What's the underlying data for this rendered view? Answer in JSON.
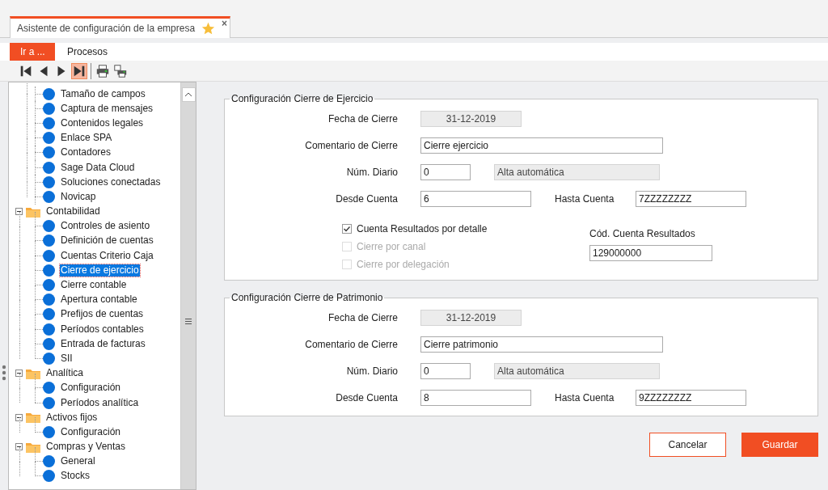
{
  "tab": {
    "title": "Asistente de configuración de la empresa",
    "selected": true,
    "favorite": true,
    "close": "×"
  },
  "menu": [
    {
      "label": "Ir a ...",
      "selected": true
    },
    {
      "label": "Procesos",
      "selected": false
    }
  ],
  "toolbar": [
    [
      {
        "kind": "first",
        "selected": false
      },
      {
        "kind": "prev",
        "selected": false
      },
      {
        "kind": "next",
        "selected": false
      },
      {
        "kind": "last",
        "selected": true
      }
    ],
    [
      {
        "kind": "print",
        "selected": false
      },
      {
        "kind": "print-setup",
        "selected": false
      }
    ]
  ],
  "tree": {
    "orphans": [
      {
        "label": "Tamaño de campos",
        "selected": false
      },
      {
        "label": "Captura de mensajes",
        "selected": false
      },
      {
        "label": "Contenidos legales",
        "selected": false
      },
      {
        "label": "Enlace SPA",
        "selected": false
      },
      {
        "label": "Contadores",
        "selected": false
      },
      {
        "label": "Sage Data Cloud",
        "selected": false
      },
      {
        "label": "Soluciones conectadas",
        "selected": false
      },
      {
        "label": "Novicap",
        "selected": false
      }
    ],
    "folders": [
      {
        "label": "Contabilidad",
        "expanded": true,
        "children": [
          {
            "label": "Controles de asiento",
            "selected": false
          },
          {
            "label": "Definición de cuentas",
            "selected": false
          },
          {
            "label": "Cuentas Criterio Caja",
            "selected": false
          },
          {
            "label": "Cierre de ejercicio",
            "selected": true
          },
          {
            "label": "Cierre contable",
            "selected": false
          },
          {
            "label": "Apertura contable",
            "selected": false
          },
          {
            "label": "Prefijos de cuentas",
            "selected": false
          },
          {
            "label": "Períodos contables",
            "selected": false
          },
          {
            "label": "Entrada de facturas",
            "selected": false
          },
          {
            "label": "SII",
            "selected": false
          }
        ]
      },
      {
        "label": "Analítica",
        "expanded": true,
        "children": [
          {
            "label": "Configuración",
            "selected": false
          },
          {
            "label": "Períodos analítica",
            "selected": false
          }
        ]
      },
      {
        "label": "Activos fijos",
        "expanded": true,
        "children": [
          {
            "label": "Configuración",
            "selected": false
          }
        ]
      },
      {
        "label": "Compras y Ventas",
        "expanded": true,
        "children": [
          {
            "label": "General",
            "selected": false
          },
          {
            "label": "Stocks",
            "selected": false
          }
        ]
      }
    ]
  },
  "sections": [
    {
      "title": "Configuración Cierre de Ejercicio",
      "rows": [
        {
          "label": "Fecha de Cierre",
          "field": {
            "kind": "date",
            "value": "31-12-2019",
            "disabled": true
          }
        },
        {
          "label": "Comentario de Cierre",
          "field": {
            "kind": "wide",
            "value": "Cierre ejercicio",
            "disabled": false
          }
        },
        {
          "label": "Núm. Diario",
          "field": {
            "kind": "short",
            "value": "0",
            "disabled": false
          },
          "side": {
            "field": {
              "kind": "info",
              "value": "Alta automática",
              "disabled": true
            }
          }
        },
        {
          "label": "Desde Cuenta",
          "field": {
            "kind": "account",
            "value": "6",
            "disabled": false
          },
          "side": {
            "label": "Hasta Cuenta",
            "field": {
              "kind": "account",
              "value": "7ZZZZZZZZ",
              "disabled": false
            }
          }
        }
      ],
      "checkboxes": [
        {
          "label": "Cuenta Resultados por detalle",
          "checked": true,
          "disabled": false
        },
        {
          "label": "Cierre por canal",
          "checked": false,
          "disabled": true
        },
        {
          "label": "Cierre por delegación",
          "checked": false,
          "disabled": true
        }
      ],
      "result_account": {
        "label": "Cód. Cuenta Resultados",
        "value": "129000000"
      }
    },
    {
      "title": "Configuración Cierre de Patrimonio",
      "rows": [
        {
          "label": "Fecha de Cierre",
          "field": {
            "kind": "date",
            "value": "31-12-2019",
            "disabled": true
          }
        },
        {
          "label": "Comentario de Cierre",
          "field": {
            "kind": "wide",
            "value": "Cierre patrimonio",
            "disabled": false
          }
        },
        {
          "label": "Núm. Diario",
          "field": {
            "kind": "short",
            "value": "0",
            "disabled": false
          },
          "side": {
            "field": {
              "kind": "info",
              "value": "Alta automática",
              "disabled": true
            }
          }
        },
        {
          "label": "Desde Cuenta",
          "field": {
            "kind": "account",
            "value": "8",
            "disabled": false
          },
          "side": {
            "label": "Hasta Cuenta",
            "field": {
              "kind": "account",
              "value": "9ZZZZZZZZ",
              "disabled": false
            }
          }
        }
      ]
    }
  ],
  "buttons": [
    {
      "label": "Cancelar",
      "kind": "secondary"
    },
    {
      "label": "Guardar",
      "kind": "primary"
    }
  ]
}
